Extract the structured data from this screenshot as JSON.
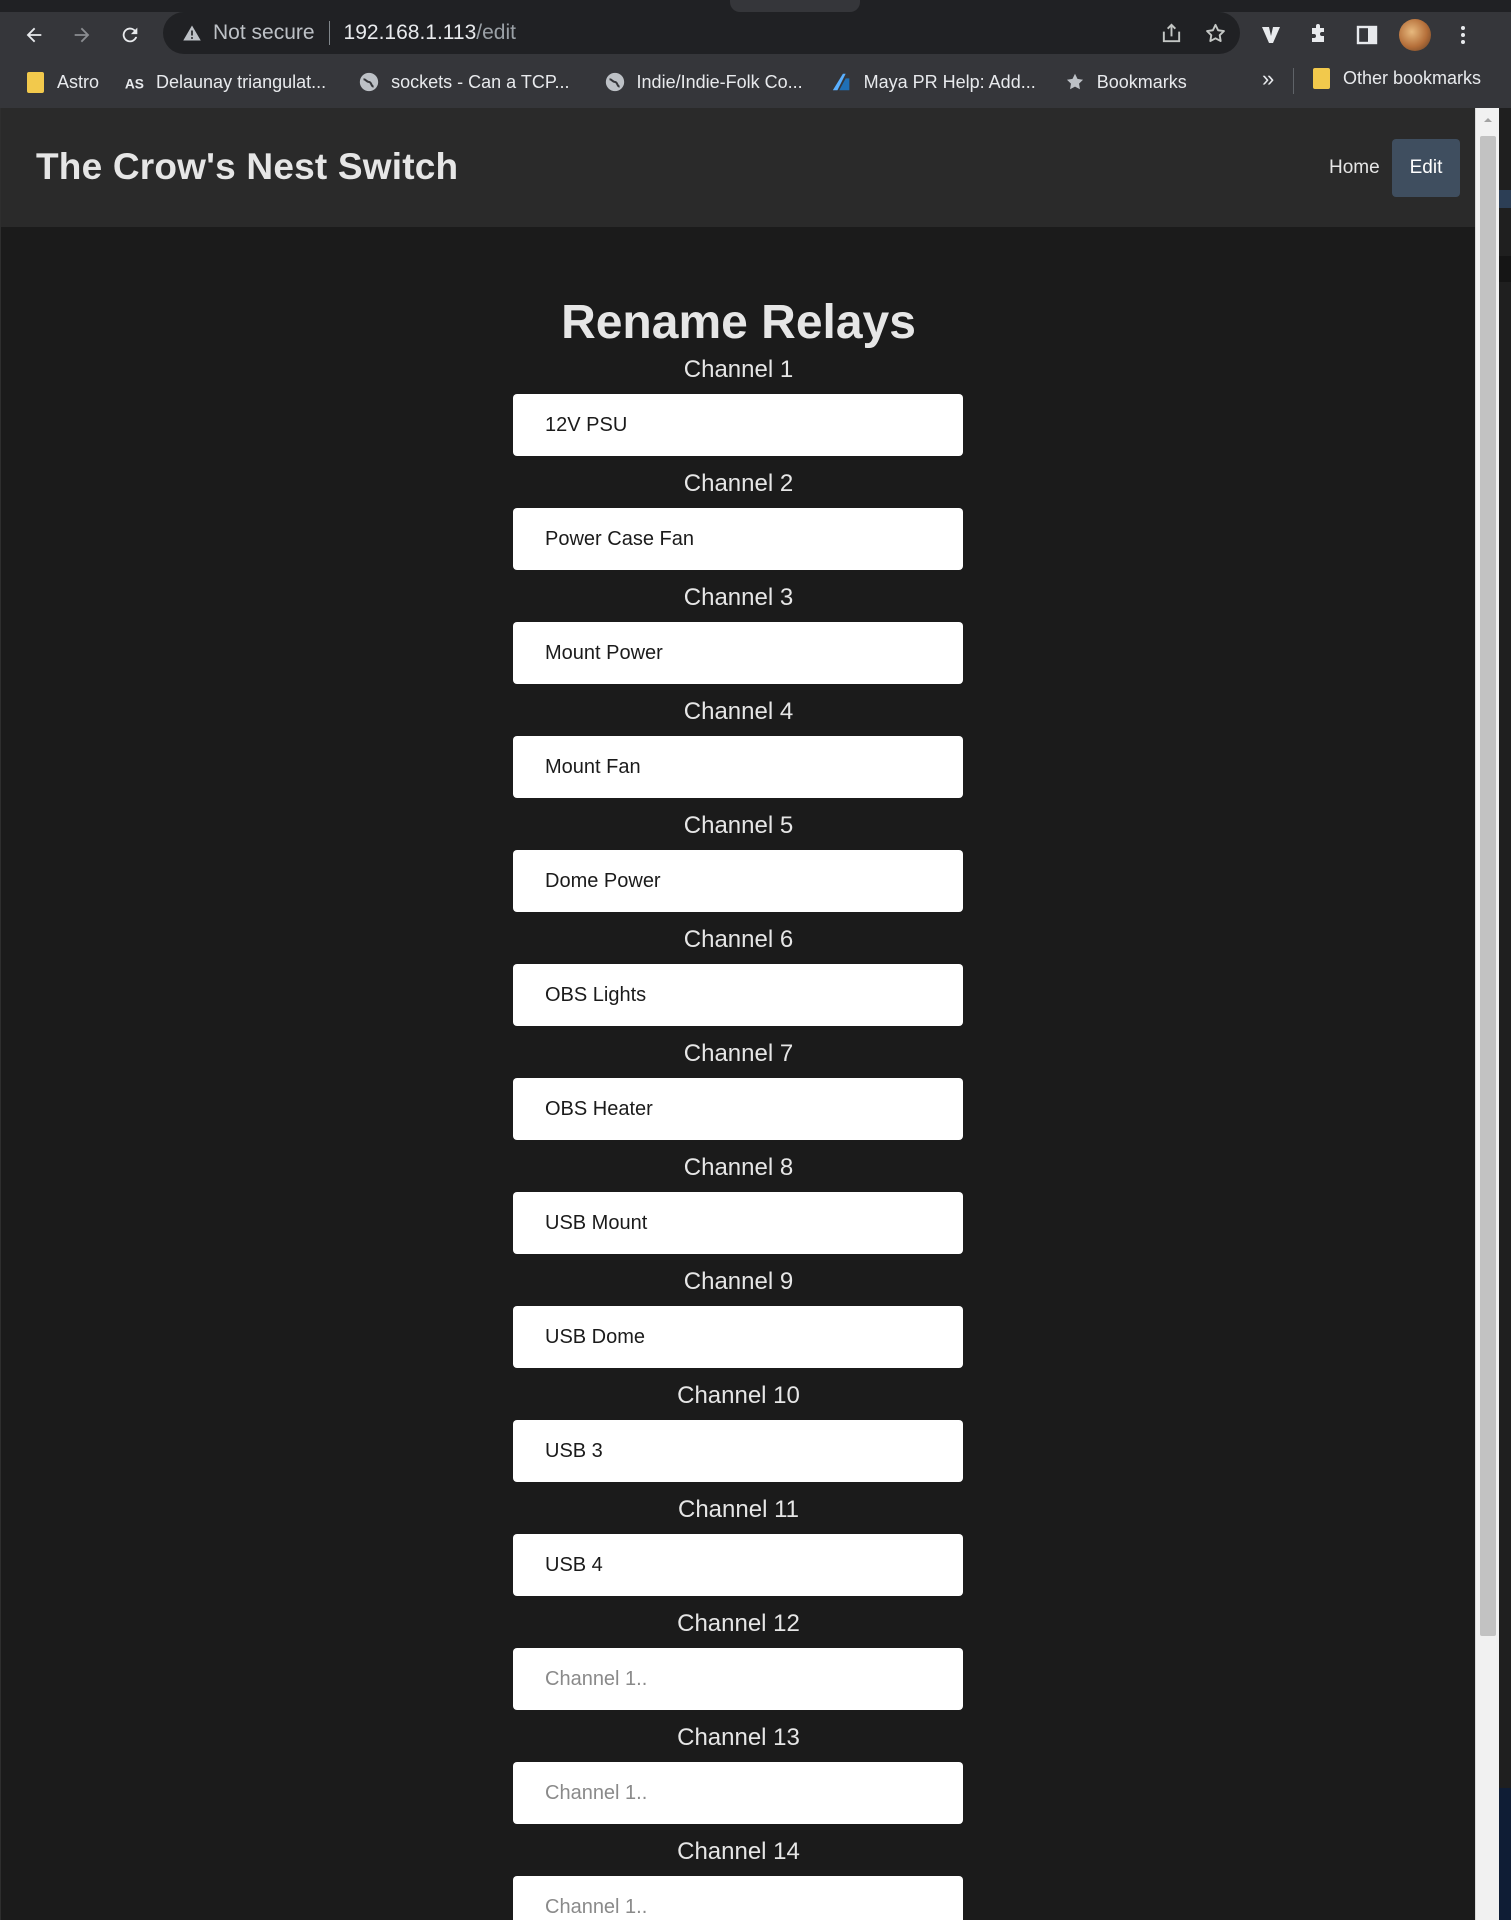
{
  "browser": {
    "omnibox": {
      "security_text": "Not secure",
      "url_host": "192.168.1.113",
      "url_path": "/edit"
    },
    "bookmarks": [
      {
        "label": "Astro",
        "icon": "folder-icon"
      },
      {
        "label": "Delaunay triangulat...",
        "icon": "as-favicon-icon"
      },
      {
        "label": "sockets - Can a TCP...",
        "icon": "globe-icon"
      },
      {
        "label": "Indie/Indie-Folk Co...",
        "icon": "globe-icon"
      },
      {
        "label": "Maya PR Help: Add...",
        "icon": "autodesk-icon"
      },
      {
        "label": "Bookmarks",
        "icon": "star-icon"
      }
    ],
    "bookmarks_overflow": "»",
    "other_bookmarks": "Other bookmarks",
    "accent": "#f2c94c"
  },
  "site": {
    "brand": "The Crow's Nest Switch",
    "nav": {
      "home": "Home",
      "edit": "Edit"
    },
    "active_nav_color": "#3f4e5f"
  },
  "page": {
    "heading": "Rename Relays",
    "relays": [
      {
        "label": "Channel 1",
        "value": "12V PSU",
        "placeholder": "Channel 1.."
      },
      {
        "label": "Channel 2",
        "value": "Power Case Fan",
        "placeholder": "Channel 1.."
      },
      {
        "label": "Channel 3",
        "value": "Mount Power",
        "placeholder": "Channel 1.."
      },
      {
        "label": "Channel 4",
        "value": "Mount Fan",
        "placeholder": "Channel 1.."
      },
      {
        "label": "Channel 5",
        "value": "Dome Power",
        "placeholder": "Channel 1.."
      },
      {
        "label": "Channel 6",
        "value": "OBS Lights",
        "placeholder": "Channel 1.."
      },
      {
        "label": "Channel 7",
        "value": "OBS Heater",
        "placeholder": "Channel 1.."
      },
      {
        "label": "Channel 8",
        "value": "USB Mount",
        "placeholder": "Channel 1.."
      },
      {
        "label": "Channel 9",
        "value": "USB Dome",
        "placeholder": "Channel 1.."
      },
      {
        "label": "Channel 10",
        "value": "USB 3",
        "placeholder": "Channel 1.."
      },
      {
        "label": "Channel 11",
        "value": "USB 4",
        "placeholder": "Channel 1.."
      },
      {
        "label": "Channel 12",
        "value": "",
        "placeholder": "Channel 1.."
      },
      {
        "label": "Channel 13",
        "value": "",
        "placeholder": "Channel 1.."
      },
      {
        "label": "Channel 14",
        "value": "",
        "placeholder": "Channel 1.."
      }
    ]
  }
}
